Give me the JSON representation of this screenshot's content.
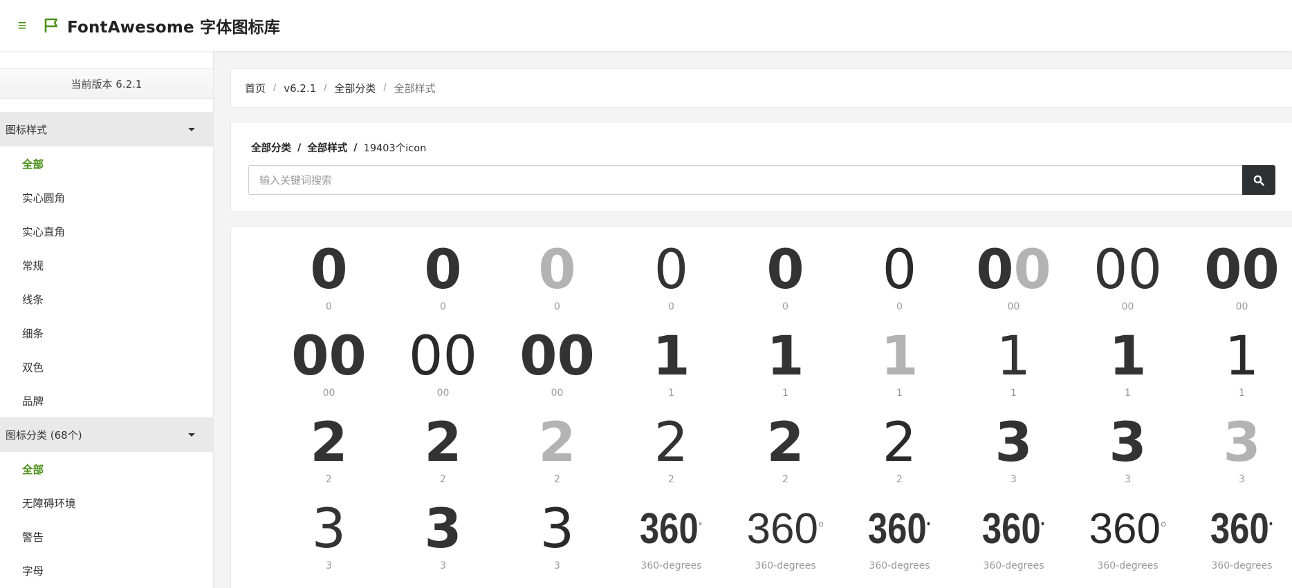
{
  "header": {
    "menu_icon": "hamburger-icon",
    "brand_icon": "flag-icon",
    "title": "FontAwesome 字体图标库",
    "accent": "#4a8f15"
  },
  "sidebar": {
    "version": "当前版本 6.2.1",
    "groups": [
      {
        "title": "图标样式",
        "items": [
          "全部",
          "实心圆角",
          "实心直角",
          "常规",
          "线条",
          "细条",
          "双色",
          "品牌"
        ]
      },
      {
        "title": "图标分类 (68个)",
        "items": [
          "全部",
          "无障碍环境",
          "警告",
          "字母"
        ]
      }
    ]
  },
  "breadcrumb": {
    "items": [
      "首页",
      "v6.2.1",
      "全部分类",
      "全部样式"
    ],
    "separator": "/"
  },
  "search": {
    "path_category": "全部分类",
    "path_style": "全部样式",
    "path_count": "19403个icon",
    "path_sep": "/",
    "placeholder": "输入关键词搜索",
    "button_icon": "search-icon"
  },
  "icons": [
    {
      "glyph": "0",
      "name": "0",
      "style": "bold"
    },
    {
      "glyph": "0",
      "name": "0",
      "style": "bold"
    },
    {
      "glyph": "0",
      "name": "0",
      "style": "light-duo"
    },
    {
      "glyph": "0",
      "name": "0",
      "style": "normal"
    },
    {
      "glyph": "0",
      "name": "0",
      "style": "bold"
    },
    {
      "glyph": "0",
      "name": "0",
      "style": "thin"
    },
    {
      "glyph": "00",
      "name": "00",
      "style": "duo"
    },
    {
      "glyph": "00",
      "name": "00",
      "style": "normal"
    },
    {
      "glyph": "00",
      "name": "00",
      "style": "bold"
    },
    {
      "glyph": "00",
      "name": "00",
      "style": "bold"
    },
    {
      "glyph": "00",
      "name": "00",
      "style": "thin"
    },
    {
      "glyph": "00",
      "name": "00",
      "style": "bold"
    },
    {
      "glyph": "1",
      "name": "1",
      "style": "bold"
    },
    {
      "glyph": "1",
      "name": "1",
      "style": "bold"
    },
    {
      "glyph": "1",
      "name": "1",
      "style": "light-duo"
    },
    {
      "glyph": "1",
      "name": "1",
      "style": "normal"
    },
    {
      "glyph": "1",
      "name": "1",
      "style": "bold"
    },
    {
      "glyph": "1",
      "name": "1",
      "style": "thin"
    },
    {
      "glyph": "2",
      "name": "2",
      "style": "bold"
    },
    {
      "glyph": "2",
      "name": "2",
      "style": "bold"
    },
    {
      "glyph": "2",
      "name": "2",
      "style": "light-duo"
    },
    {
      "glyph": "2",
      "name": "2",
      "style": "normal"
    },
    {
      "glyph": "2",
      "name": "2",
      "style": "bold"
    },
    {
      "glyph": "2",
      "name": "2",
      "style": "thin"
    },
    {
      "glyph": "3",
      "name": "3",
      "style": "bold"
    },
    {
      "glyph": "3",
      "name": "3",
      "style": "bold"
    },
    {
      "glyph": "3",
      "name": "3",
      "style": "light-duo"
    },
    {
      "glyph": "3",
      "name": "3",
      "style": "normal"
    },
    {
      "glyph": "3",
      "name": "3",
      "style": "bold"
    },
    {
      "glyph": "3",
      "name": "3",
      "style": "thin"
    },
    {
      "glyph": "360",
      "name": "360-degrees",
      "style": "deg-bold"
    },
    {
      "glyph": "360",
      "name": "360-degrees",
      "style": "deg-normal"
    },
    {
      "glyph": "360",
      "name": "360-degrees",
      "style": "deg-bold"
    },
    {
      "glyph": "360",
      "name": "360-degrees",
      "style": "deg-bold"
    },
    {
      "glyph": "360",
      "name": "360-degrees",
      "style": "deg-thin"
    },
    {
      "glyph": "360",
      "name": "360-degrees",
      "style": "deg-bold"
    }
  ]
}
